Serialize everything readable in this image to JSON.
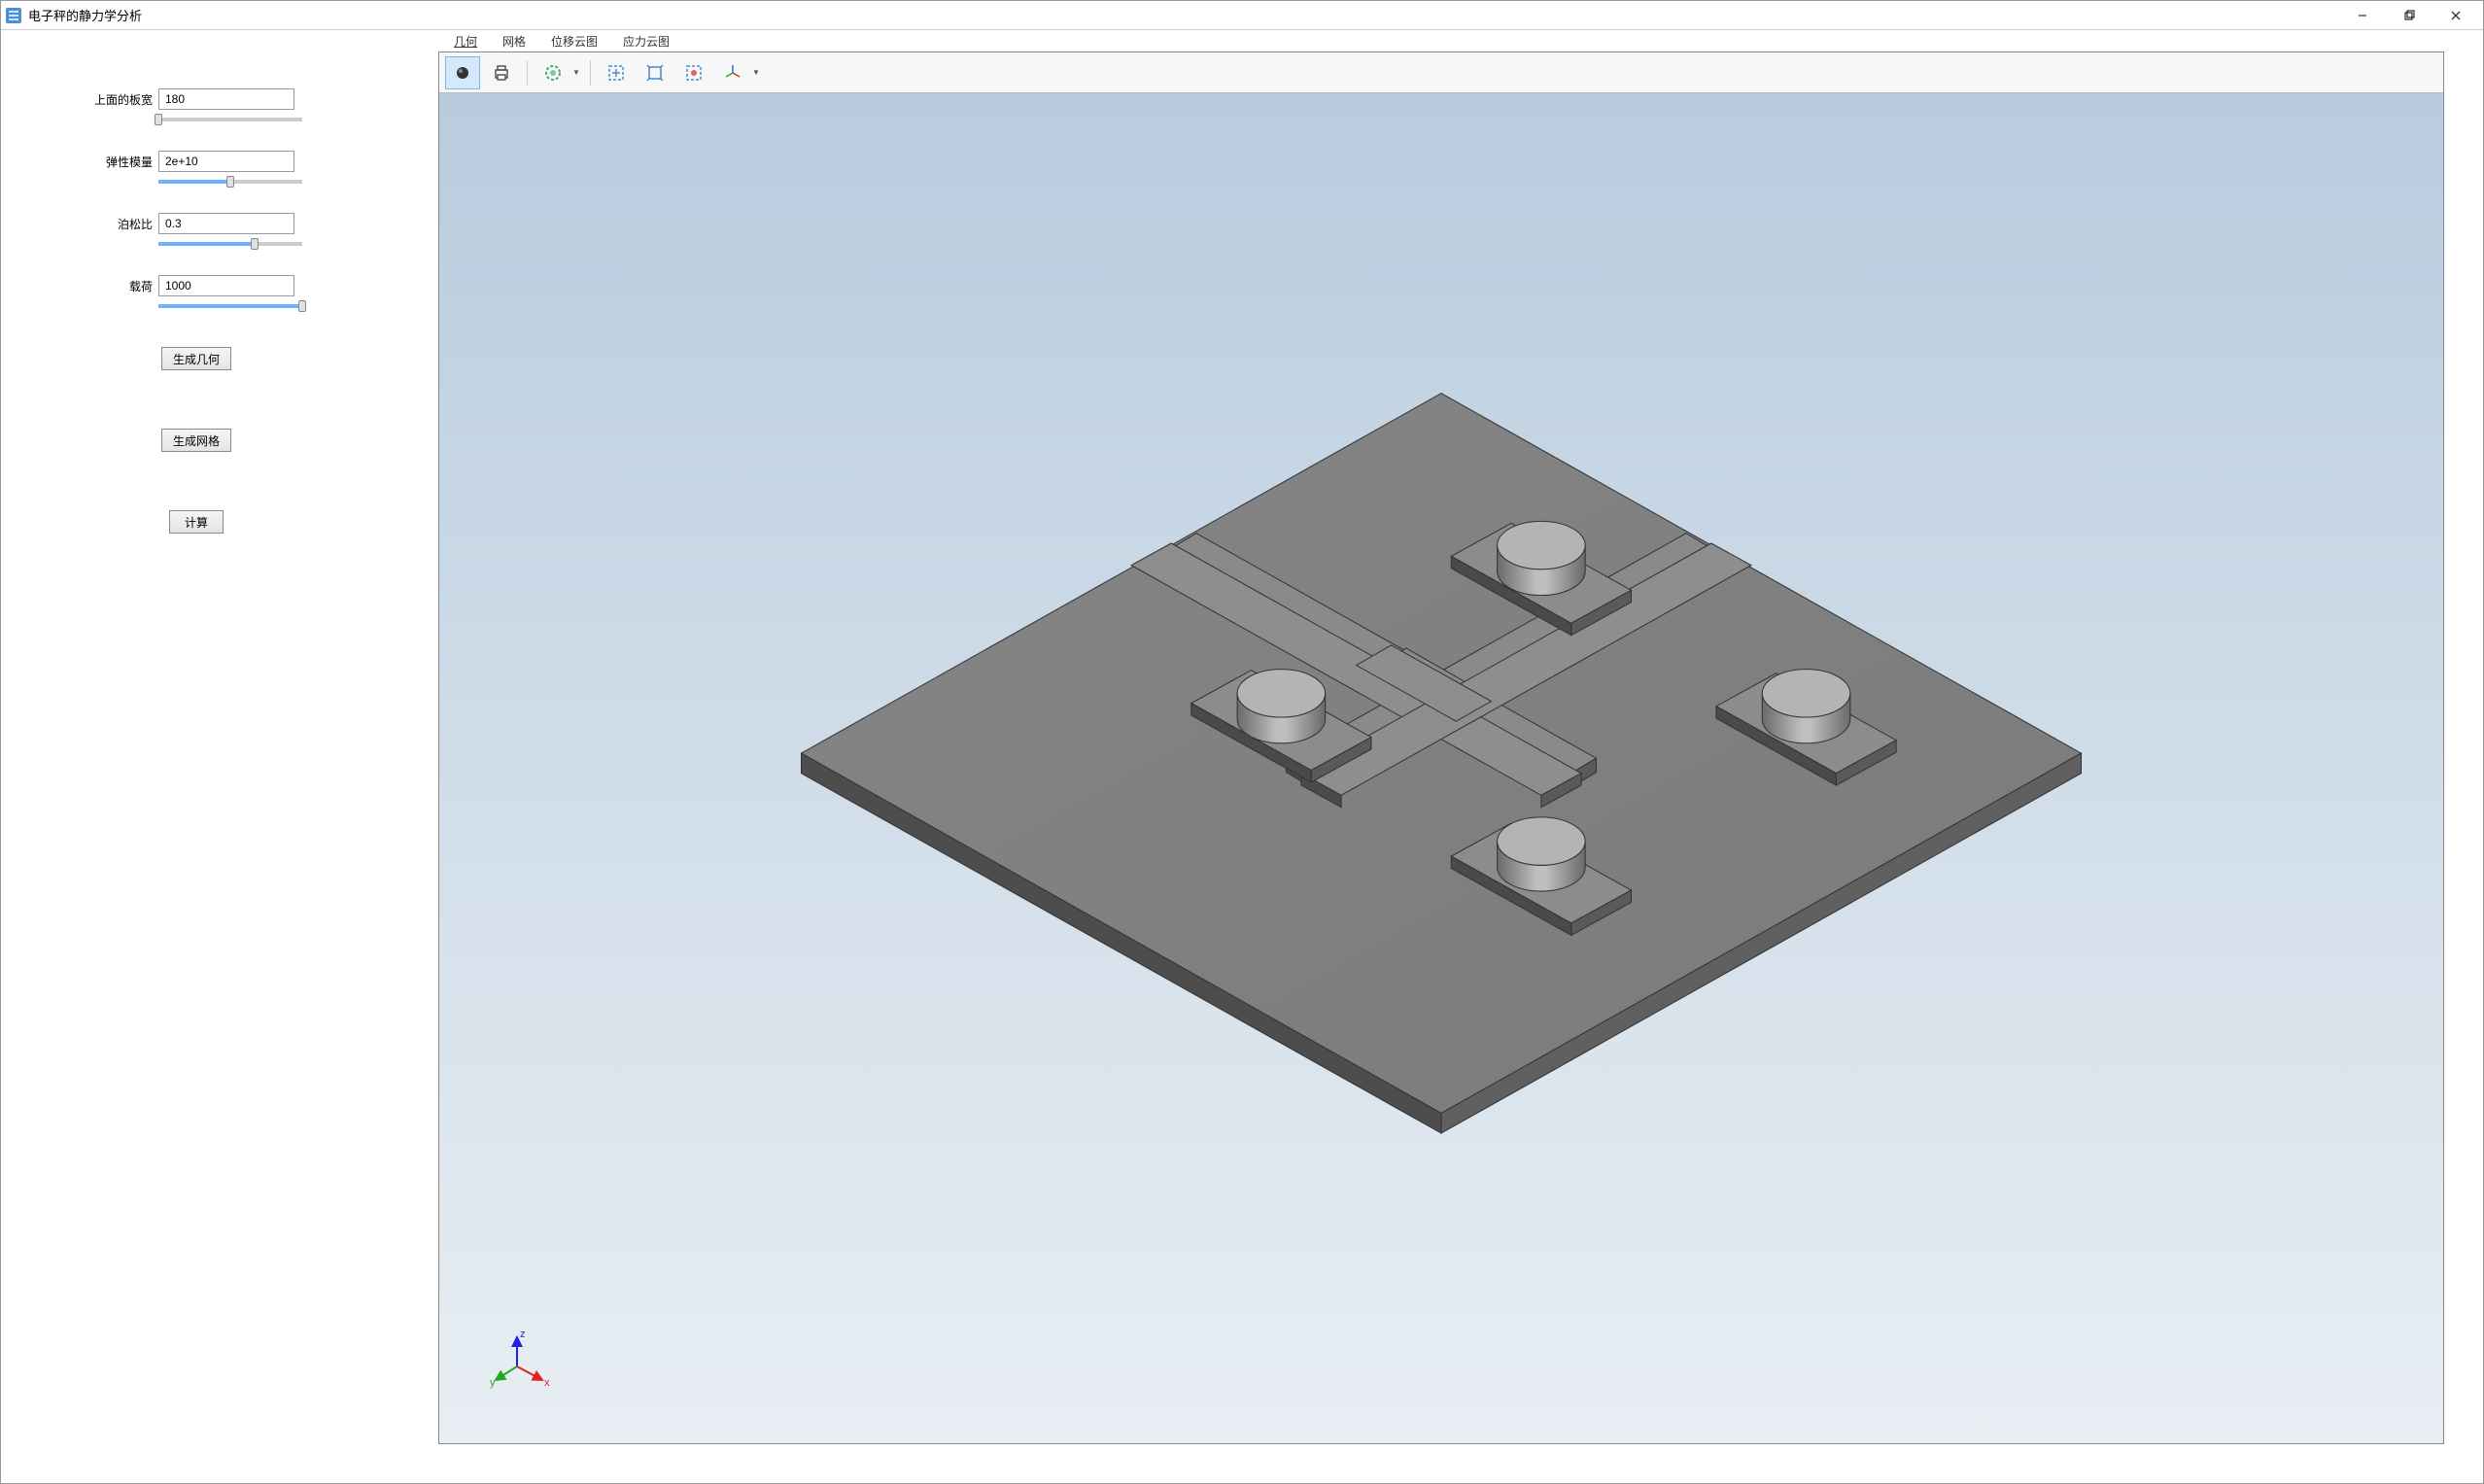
{
  "window": {
    "title": "电子秤的静力学分析"
  },
  "sidebar": {
    "params": [
      {
        "label": "上面的板宽",
        "value": "180",
        "slider_pct": 0
      },
      {
        "label": "弹性模量",
        "value": "2e+10",
        "slider_pct": 50
      },
      {
        "label": "泊松比",
        "value": "0.3",
        "slider_pct": 67
      },
      {
        "label": "载荷",
        "value": "1000",
        "slider_pct": 100
      }
    ],
    "buttons": {
      "generate_geometry": "生成几何",
      "generate_mesh": "生成网格",
      "compute": "计算"
    }
  },
  "tabs": [
    {
      "label": "几何",
      "active": true
    },
    {
      "label": "网格",
      "active": false
    },
    {
      "label": "位移云图",
      "active": false
    },
    {
      "label": "应力云图",
      "active": false
    }
  ],
  "toolbar": {
    "icons": [
      "scene-light",
      "print",
      "transparency",
      "zoom-box",
      "zoom-extents",
      "zoom-selected",
      "view-default"
    ]
  },
  "axis": {
    "x": "x",
    "y": "y",
    "z": "z"
  }
}
